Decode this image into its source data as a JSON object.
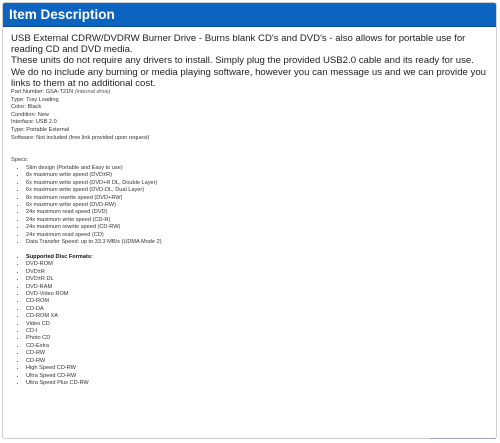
{
  "header": {
    "title": "Item Description"
  },
  "intro": {
    "line1": "USB External CDRW/DVDRW Burner Drive  - Burns blank CD's and DVD's - also allows for portable use for reading CD and DVD media.",
    "line2": "These units do not require any drivers to install. Simply plug the provided USB2.0 cable and its ready for use.",
    "line3": "We do no include any burning or media playing software, however you can message us and we can provide you links to them at no additional cost."
  },
  "specs": {
    "part_number_label": "Part Number: GSA-T21N",
    "part_number_note": "(internal drive)",
    "type1": "Type: Tray Loading",
    "color": "Color: Black",
    "condition": "Condition: New",
    "interface": "Interface: USB 2.0",
    "type2": "Type: Portable External",
    "software": "Software: Not included (free link provided upon request)",
    "specs_heading": "Specs:"
  },
  "features": [
    "Slim design (Portable and Easy to use)",
    "8x maximum write speed (DVD±R)",
    "6x maximum write speed (DVD+R DL, Double Layer)",
    "6x maximum write speed (DVD-DL, Dual Layer)",
    "8x maximum rewrite speed (DVD+RW)",
    "6x maximum write speed (DVD-RW)",
    "24x maximum read speed (DVD)",
    "24x maximum write speed (CD-R)",
    "24x maximum rewrite speed (CD-RW)",
    "24x maximum read speed (CD)",
    "Data Transfer Speed: up to 33.3 MB/s (UDMA Mode 2)"
  ],
  "formats": {
    "title": "Supported Disc Formats:",
    "items": [
      "DVD-ROM",
      "DVD±R",
      "DVD±R DL",
      "DVD-RAM",
      "DVD-Video ROM",
      "CD-ROM",
      "CD-DA",
      "CD-ROM XA",
      "Video CD",
      "CD-I",
      "Photo CD",
      "CD-Extra",
      "CD-RW",
      "CD-RW",
      "High Speed CD-RW",
      "Ultra Speed CD-RW",
      "Ultra Speed Plus CD-RW"
    ]
  }
}
